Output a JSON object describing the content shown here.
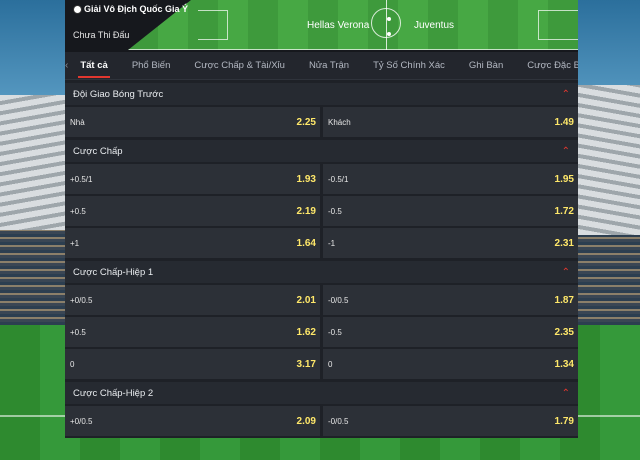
{
  "header": {
    "league": "Giải Vô Địch Quốc Gia Ý",
    "status": "Chưa Thi Đấu",
    "home_team": "Hellas Verona",
    "away_team": "Juventus"
  },
  "tabs": [
    "Tất cả",
    "Phổ Biến",
    "Cược Chấp & Tài/Xỉu",
    "Nửa Trận",
    "Tỷ Số Chính Xác",
    "Ghi Bàn",
    "Cược Đặc Biệt"
  ],
  "markets": [
    {
      "title": "Đội Giao Bóng Trước",
      "rows": [
        [
          {
            "label": "Nhà",
            "odds": "2.25"
          },
          {
            "label": "Khách",
            "odds": "1.49"
          }
        ]
      ]
    },
    {
      "title": "Cược Chấp",
      "rows": [
        [
          {
            "label": "+0.5/1",
            "odds": "1.93"
          },
          {
            "label": "-0.5/1",
            "odds": "1.95"
          }
        ],
        [
          {
            "label": "+0.5",
            "odds": "2.19"
          },
          {
            "label": "-0.5",
            "odds": "1.72"
          }
        ],
        [
          {
            "label": "+1",
            "odds": "1.64"
          },
          {
            "label": "-1",
            "odds": "2.31"
          }
        ]
      ]
    },
    {
      "title": "Cược Chấp-Hiệp 1",
      "rows": [
        [
          {
            "label": "+0/0.5",
            "odds": "2.01"
          },
          {
            "label": "-0/0.5",
            "odds": "1.87"
          }
        ],
        [
          {
            "label": "+0.5",
            "odds": "1.62"
          },
          {
            "label": "-0.5",
            "odds": "2.35"
          }
        ],
        [
          {
            "label": "0",
            "odds": "3.17"
          },
          {
            "label": "0",
            "odds": "1.34"
          }
        ]
      ]
    },
    {
      "title": "Cược Chấp-Hiệp 2",
      "rows": [
        [
          {
            "label": "+0/0.5",
            "odds": "2.09"
          },
          {
            "label": "-0/0.5",
            "odds": "1.79"
          }
        ]
      ]
    }
  ],
  "colors": {
    "accent": "#e2372f",
    "odds": "#ffe86a"
  }
}
